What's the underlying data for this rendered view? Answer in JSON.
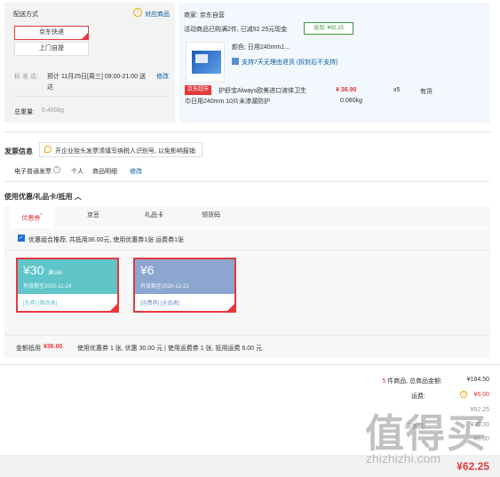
{
  "shipping": {
    "title": "配送方式",
    "support_goods": "对应商品",
    "options": [
      "京东快递",
      "上门自提"
    ],
    "delivery_label": "标 准 达:",
    "delivery_value_line1": "预计 11月25日[周三] 09:00-21:00 送",
    "delivery_value_line2": "达",
    "modify": "修改",
    "total_weight_label": "总重量:",
    "total_weight_value": "0.400kg"
  },
  "order": {
    "seller": "商家: 京东自营",
    "promo": "活动商品已购满2件, 已减92.25元现金",
    "promo_badge": "返现: ¥92.25",
    "color_line": "颜色: 日用240mm1...",
    "return_policy": "支持7天无理由退货 (拆封后不支持)",
    "jd_super_badge": "京东超市",
    "product_name_line1": "护舒宝Always欧美进口液体卫生",
    "product_name_line2": "巾日用240mm 10片未渗漏防护",
    "price": "¥ 36.90",
    "qty": "x5",
    "stock": "有货",
    "weight": "0.080kg"
  },
  "invoice": {
    "title": "发票信息",
    "tip": "开企业抬头发票须填写纳税人识别号, 以免影响报销",
    "type": "电子普通发票",
    "personal": "个人",
    "detail": "商品明细",
    "modify": "修改"
  },
  "discount": {
    "title": "使用优惠/礼品卡/抵用",
    "tabs": [
      "优惠券",
      "京豆",
      "礼品卡",
      "领货码"
    ],
    "tab_required_mark": "*",
    "auto_select": "优惠组合推荐, 共抵用36.00元, 使用优惠券1张 运费券1张",
    "coupons": [
      {
        "amount": "¥30",
        "condition": "满169",
        "valid": "有效期至2020-11-24",
        "tags": "[东券] [限品类]"
      },
      {
        "amount": "¥6",
        "condition": "",
        "valid": "有效期至2020-12-22",
        "tags": "[运费券] [全品类]"
      }
    ],
    "total_label": "金额抵用",
    "total_value": "¥36.00",
    "total_desc": "使用优惠券 1 张, 优惠 30.00 元 | 使用运费券 1 张, 抵用运费 6.00 元"
  },
  "summary": {
    "count_prefix": "5",
    "count_text": " 件商品, 总商品金额:",
    "goods_total": "¥184.50",
    "shipping_label": "运费:",
    "shipping_value": "¥6.00",
    "row3_value": "¥92.25",
    "row4_label": "服务费:",
    "row4_value": "¥30.00",
    "row5_value": "¥6.00",
    "pay_value": "¥62.25"
  },
  "watermark": {
    "chars": "值得买",
    "url": "zhizhizhi.com"
  },
  "colors": {
    "accent": "#e4393c",
    "link": "#005aa0",
    "coupon1": "#5fc5c9",
    "coupon2": "#8ca6cf"
  }
}
